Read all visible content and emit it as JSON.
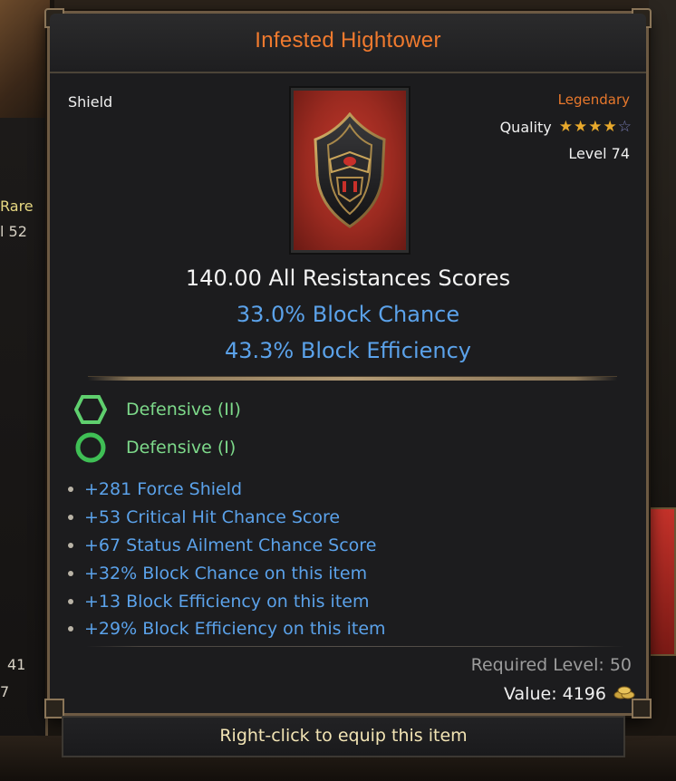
{
  "background": {
    "left_rarity": "Rare",
    "left_level": "l 52",
    "left_count": "41",
    "left_value": "7"
  },
  "item": {
    "name": "Infested Hightower",
    "type": "Shield",
    "rarity": "Legendary",
    "quality_label": "Quality",
    "quality_stars": 4,
    "quality_max": 5,
    "level": "Level 74",
    "icon": "shield-icon"
  },
  "main_stats": [
    "140.00 All Resistances Scores",
    "33.0% Block Chance",
    "43.3% Block Efficiency"
  ],
  "affixes": [
    {
      "icon": "hexagon-icon",
      "label": "Defensive (II)"
    },
    {
      "icon": "circle-icon",
      "label": "Defensive (I)"
    }
  ],
  "mods": [
    "+281 Force Shield",
    "+53 Critical Hit Chance Score",
    "+67 Status Ailment Chance Score",
    "+32% Block Chance on this item",
    "+13 Block Efficiency on this item",
    "+29% Block Efficiency on this item"
  ],
  "requirements": {
    "required_level": "Required Level: 50",
    "value": "Value: 4196",
    "currency_icon": "gold-coins-icon"
  },
  "footer": {
    "hint": "Right-click to equip this item"
  },
  "colors": {
    "title": "#f07a2e",
    "legendary": "#e8782c",
    "magic_blue": "#5ba2ea",
    "affix_green": "#7dd98a"
  }
}
